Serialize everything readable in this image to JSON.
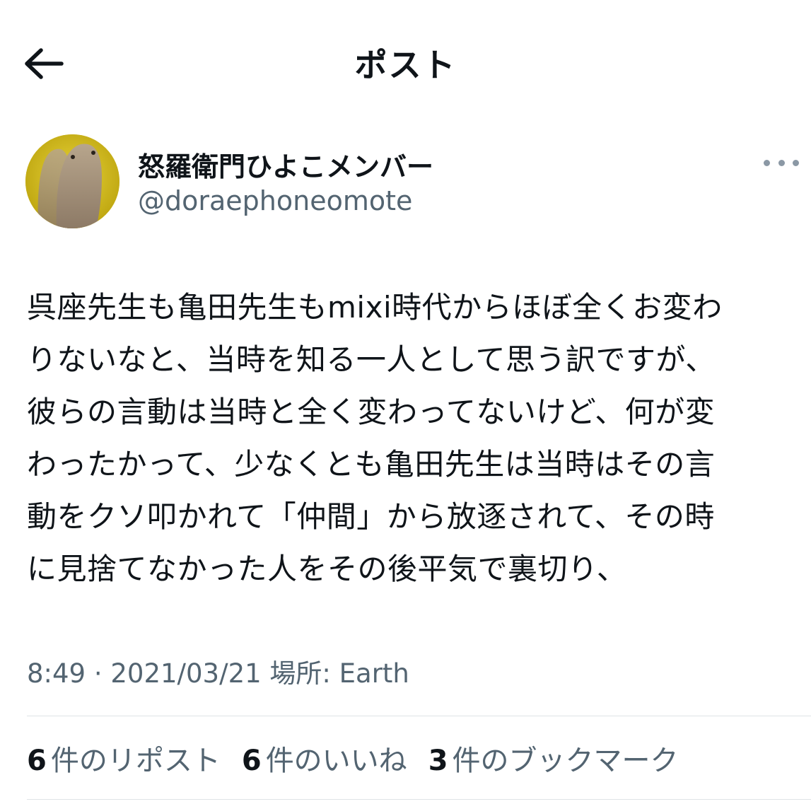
{
  "header": {
    "title": "ポスト"
  },
  "author": {
    "display_name": "怒羅衛門ひよこメンバー",
    "handle": "@doraephoneomote"
  },
  "post": {
    "lines": [
      "呉座先生も亀田先生もmixi時代からほぼ全くお変わ",
      "りないなと、当時を知る一人として思う訳ですが、",
      "彼らの言動は当時と全く変わってないけど、何が変",
      "わったかって、少なくとも亀田先生は当時はその言",
      "動をクソ叩かれて「仲間」から放逐されて、その時",
      "に見捨てなかった人をその後平気で裏切り、"
    ]
  },
  "meta": {
    "time": "8:49",
    "separator": "·",
    "date": "2021/03/21",
    "location_label": "場所:",
    "location": "Earth"
  },
  "stats": {
    "reposts_count": "6",
    "reposts_label": "件のリポスト",
    "likes_count": "6",
    "likes_label": "件のいいね",
    "bookmarks_count": "3",
    "bookmarks_label": "件のブックマーク"
  },
  "icons": {
    "back": "arrow-left-icon",
    "more": "more-horizontal-icon"
  },
  "colors": {
    "text_primary": "#0f1419",
    "text_secondary": "#536471",
    "divider": "#dfe3e6",
    "avatar_bg": "#d9c21a"
  }
}
